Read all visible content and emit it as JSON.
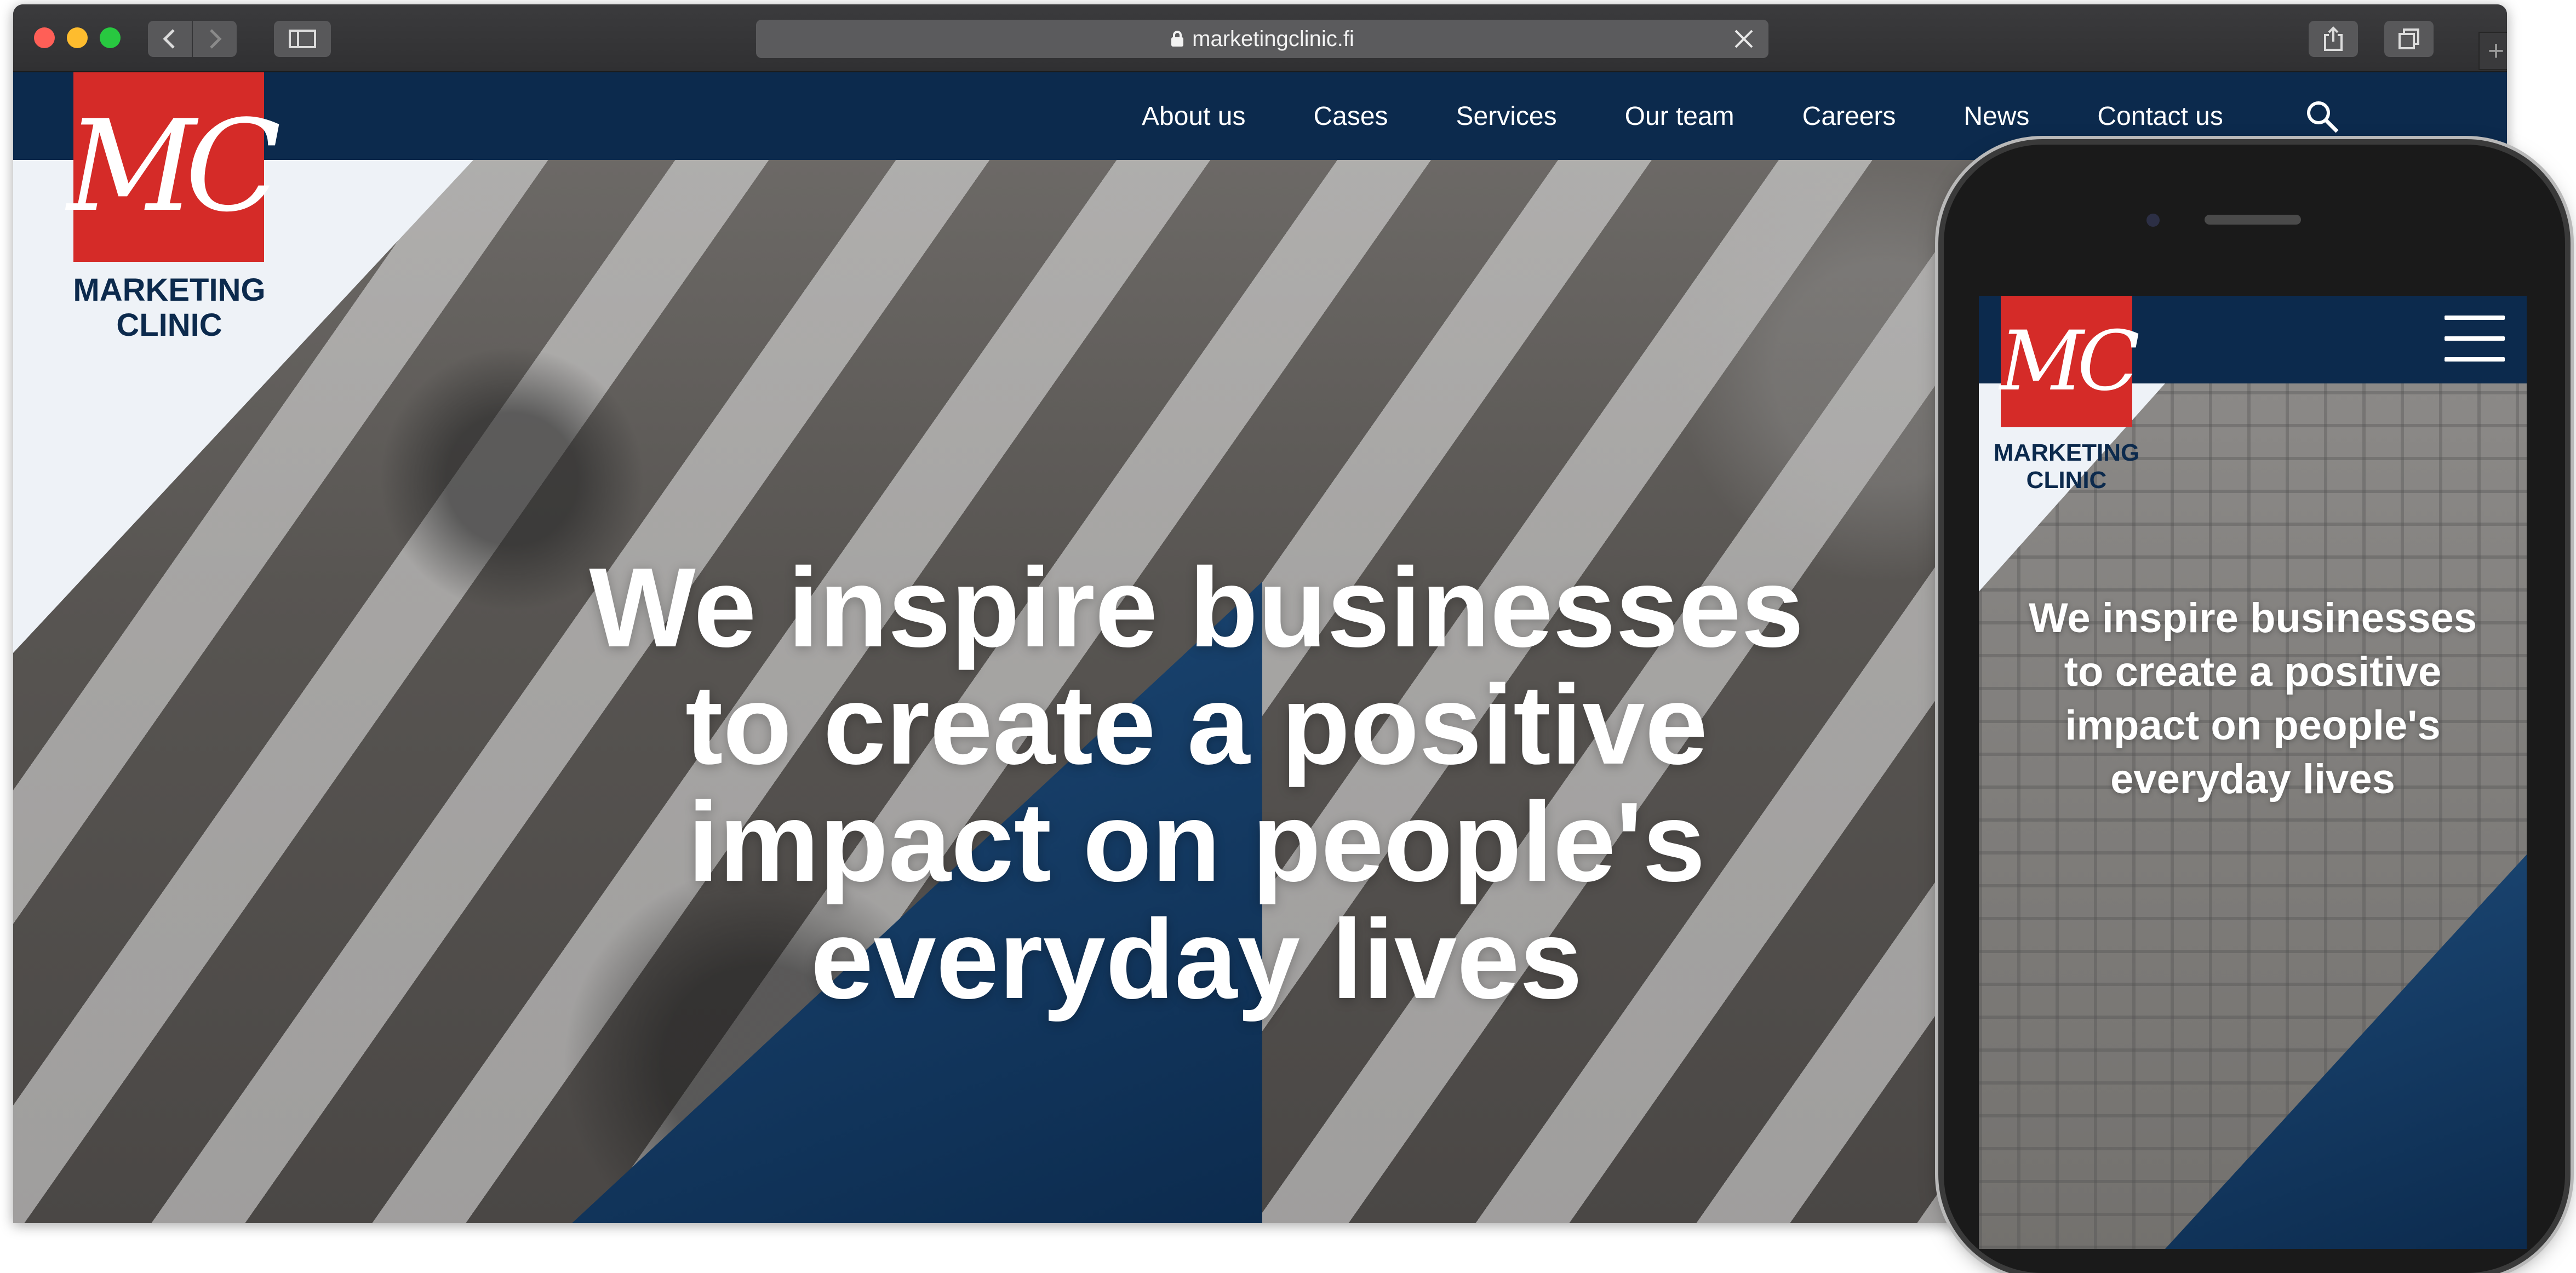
{
  "browser": {
    "url": "marketingclinic.fi",
    "new_tab_label": "+"
  },
  "site": {
    "nav": [
      "About us",
      "Cases",
      "Services",
      "Our team",
      "Careers",
      "News",
      "Contact us"
    ],
    "logo_mark": "MC",
    "logo_text_line1": "MARKETING",
    "logo_text_line2": "CLINIC",
    "headline_lines": [
      "We inspire businesses",
      "to create a positive",
      "impact on people's",
      "everyday lives"
    ]
  },
  "mobile": {
    "logo_mark": "MC",
    "logo_text_line1": "MARKETING",
    "logo_text_line2": "CLINIC",
    "headline_lines": [
      "We inspire businesses",
      "to create a positive",
      "impact on people's",
      "everyday lives"
    ]
  },
  "colors": {
    "nav_navy": "#0c2a4d",
    "logo_red": "#d52b28"
  }
}
